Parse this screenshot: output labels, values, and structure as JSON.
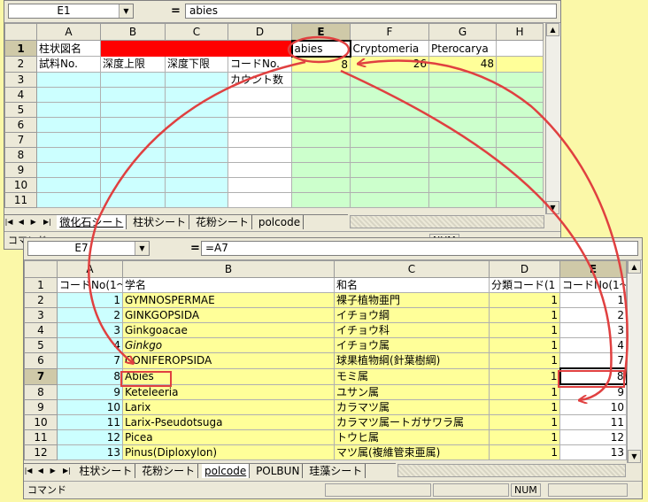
{
  "top": {
    "name_box": "E1",
    "formula_eq": "=",
    "formula": "abies",
    "col_headers": [
      "A",
      "B",
      "C",
      "D",
      "E",
      "F",
      "G",
      "H"
    ],
    "rows": [
      {
        "num": "1",
        "a": "柱状図名",
        "b": "",
        "c": "",
        "d": "",
        "e": "abies",
        "f": "Cryptomeria",
        "g": "Pterocarya",
        "h": ""
      },
      {
        "num": "2",
        "a": "試料No.",
        "b": "深度上限",
        "c": "深度下限",
        "d": "コードNo.",
        "e": "8",
        "f": "26",
        "g": "48",
        "h": ""
      },
      {
        "num": "3",
        "a": "",
        "b": "",
        "c": "",
        "d": "カウント数",
        "e": "",
        "f": "",
        "g": "",
        "h": ""
      },
      {
        "num": "4"
      },
      {
        "num": "5"
      },
      {
        "num": "6"
      },
      {
        "num": "7"
      },
      {
        "num": "8"
      },
      {
        "num": "9"
      },
      {
        "num": "10"
      },
      {
        "num": "11"
      }
    ],
    "tabs": [
      "微化石シート",
      "柱状シート",
      "花粉シート",
      "polcode"
    ],
    "status_label": "コマンド",
    "status_num": "NUM"
  },
  "bottom": {
    "name_box": "E7",
    "formula_eq": "=",
    "formula": "=A7",
    "col_headers": [
      "A",
      "B",
      "C",
      "D",
      "E"
    ],
    "header_row": {
      "num": "1",
      "a": "コードNo(1～",
      "b": "学名",
      "c": "和名",
      "d": "分類コード(1",
      "e": "コードNo(1～"
    },
    "rows": [
      {
        "num": "2",
        "a": "1",
        "b": "GYMNOSPERMAE",
        "c": "裸子植物亜門",
        "d": "1",
        "e": "1"
      },
      {
        "num": "3",
        "a": "2",
        "b": "GINKGOPSIDA",
        "c": "イチョウ綱",
        "d": "1",
        "e": "2"
      },
      {
        "num": "4",
        "a": "3",
        "b": "Ginkgoacae",
        "c": "イチョウ科",
        "d": "1",
        "e": "3"
      },
      {
        "num": "5",
        "a": "4",
        "b": "Ginkgo",
        "c": "イチョウ属",
        "d": "1",
        "e": "4"
      },
      {
        "num": "6",
        "a": "7",
        "b": "CONIFEROPSIDA",
        "c": "球果植物綱(針葉樹綱)",
        "d": "1",
        "e": "7"
      },
      {
        "num": "7",
        "a": "8",
        "b": "Abies",
        "c": "モミ属",
        "d": "1",
        "e": "8"
      },
      {
        "num": "8",
        "a": "9",
        "b": "Keteleeria",
        "c": "ユサン属",
        "d": "1",
        "e": "9"
      },
      {
        "num": "9",
        "a": "10",
        "b": "Larix",
        "c": "カラマツ属",
        "d": "1",
        "e": "10"
      },
      {
        "num": "10",
        "a": "11",
        "b": "Larix-Pseudotsuga",
        "c": "カラマツ属ートガサワラ属",
        "d": "1",
        "e": "11"
      },
      {
        "num": "11",
        "a": "12",
        "b": "Picea",
        "c": "トウヒ属",
        "d": "1",
        "e": "12"
      },
      {
        "num": "12",
        "a": "13",
        "b": "Pinus(Diploxylon)",
        "c": "マツ属(複維管束亜属)",
        "d": "1",
        "e": "13"
      }
    ],
    "tabs": [
      "柱状シート",
      "花粉シート",
      "polcode",
      "POLBUN",
      "珪藻シート"
    ],
    "status_label": "コマンド",
    "status_num": "NUM"
  },
  "colors": {
    "background": "#fbf8a8",
    "highlight_red": "#ff0000",
    "annotation": "#e04040"
  },
  "icons": [
    "dropdown-arrow-icon",
    "scroll-up-icon",
    "scroll-down-icon",
    "tab-first-icon",
    "tab-prev-icon",
    "tab-next-icon",
    "tab-last-icon"
  ]
}
